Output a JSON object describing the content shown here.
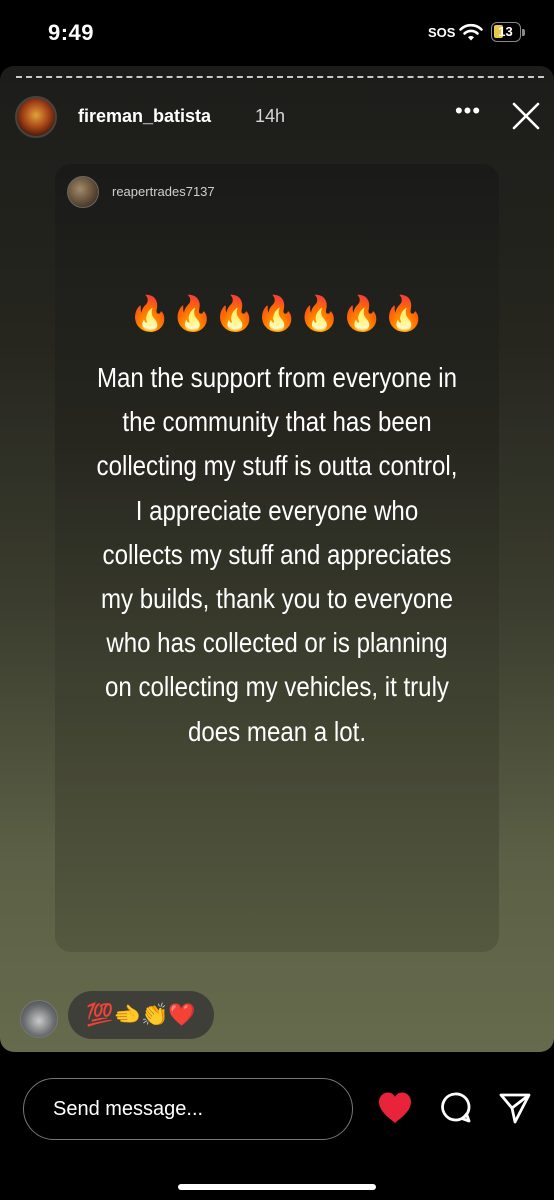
{
  "status_bar": {
    "time": "9:49",
    "sos": "SOS",
    "battery": "13",
    "battery_color": "#e6c84a"
  },
  "header": {
    "username": "fireman_batista",
    "age": "14h",
    "more_label": "•••",
    "more_icon": "more-horizontal-icon",
    "close_icon": "close-icon"
  },
  "card": {
    "username": "reapertrades7137",
    "emojis": "🔥🔥🔥🔥🔥🔥🔥",
    "message": "Man the support from everyone in the community that has been collecting my stuff is outta control, I appreciate everyone who collects my stuff and appreciates my builds, thank you to everyone who has collected or is planning on collecting my vehicles, it truly does mean a lot."
  },
  "reactions": {
    "emojis": "💯🫲👏❤️"
  },
  "bottom": {
    "send_placeholder": "Send message...",
    "heart_icon": "heart-icon",
    "heart_color": "#e8233a",
    "comment_icon": "comment-icon",
    "share_icon": "send-icon"
  }
}
